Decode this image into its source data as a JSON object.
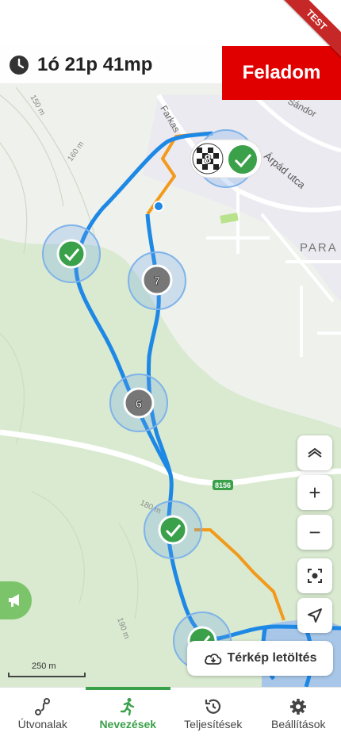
{
  "badge": {
    "text": "TEST"
  },
  "timer": {
    "elapsed": "1ó 21p 41mp"
  },
  "give_up": {
    "label": "Feladom"
  },
  "map": {
    "streets": [
      "Farkas",
      "Sándor",
      "Árpád utca"
    ],
    "place_label": "PARA",
    "road_number": "8156",
    "contours": [
      "150 m",
      "160 m",
      "180 m",
      "190 m"
    ],
    "checkpoints": [
      {
        "number": "8",
        "status": "finish"
      },
      {
        "number": "7",
        "status": "pending"
      },
      {
        "number": "6",
        "status": "pending"
      },
      {
        "number": "",
        "status": "done"
      },
      {
        "number": "",
        "status": "done"
      },
      {
        "number": "",
        "status": "done"
      },
      {
        "number": "",
        "status": "done"
      }
    ],
    "scale_label": "250 m"
  },
  "controls": {
    "layers": "layers-icon",
    "zoom_in": "+",
    "zoom_out": "−",
    "recenter": "focus-icon",
    "locate": "navigation-arrow-icon",
    "voice": "megaphone-icon"
  },
  "download": {
    "label": "Térkép letöltés"
  },
  "nav": [
    {
      "label": "Útvonalak",
      "icon": "route-icon",
      "active": false
    },
    {
      "label": "Nevezések",
      "icon": "runner-icon",
      "active": true
    },
    {
      "label": "Teljesítések",
      "icon": "history-icon",
      "active": false
    },
    {
      "label": "Beállítások",
      "icon": "gear-icon",
      "active": false
    }
  ],
  "colors": {
    "route": "#1e88e5",
    "track": "#f29a1b",
    "done": "#3aa04a",
    "give_up": "#e00000",
    "nav_active": "#3aa04a"
  }
}
